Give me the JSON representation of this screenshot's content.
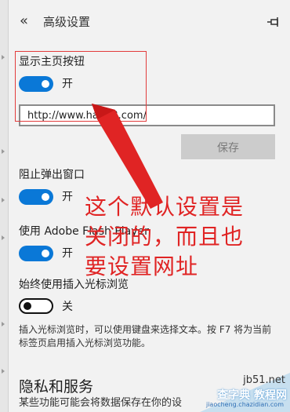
{
  "header": {
    "back_glyph": "«",
    "title": "高级设置",
    "pin_icon": "pin-icon"
  },
  "home_button": {
    "label": "显示主页按钮",
    "toggle_state": "开",
    "toggle_on": true,
    "url_value": "http://www.ha123.com/",
    "save_label": "保存"
  },
  "popup_block": {
    "label": "阻止弹出窗口",
    "toggle_state": "开",
    "toggle_on": true
  },
  "flash": {
    "label": "使用 Adobe Flash Player",
    "toggle_state": "开",
    "toggle_on": true
  },
  "caret_browsing": {
    "label": "始终使用插入光标浏览",
    "toggle_state": "关",
    "toggle_on": false,
    "description": "插入光标浏览时，可以使用键盘来选择文本。按 F7 将为当前标签页启用插入光标浏览功能。"
  },
  "privacy": {
    "title": "隐私和服务",
    "subtitle": "某些功能可能会将数据保存在你的设"
  },
  "annotation": {
    "lines": [
      "这个默认设置是",
      "关闭的，而且也",
      "要设置网址"
    ],
    "color": "#e02424"
  },
  "watermark": {
    "site": "jb51.net",
    "name": "查字典 教程网",
    "url": "jiaocheng.chazidian.com"
  },
  "colors": {
    "accent": "#0a78d7",
    "background": "#f2f2f2",
    "annotation_red": "#e02424"
  }
}
